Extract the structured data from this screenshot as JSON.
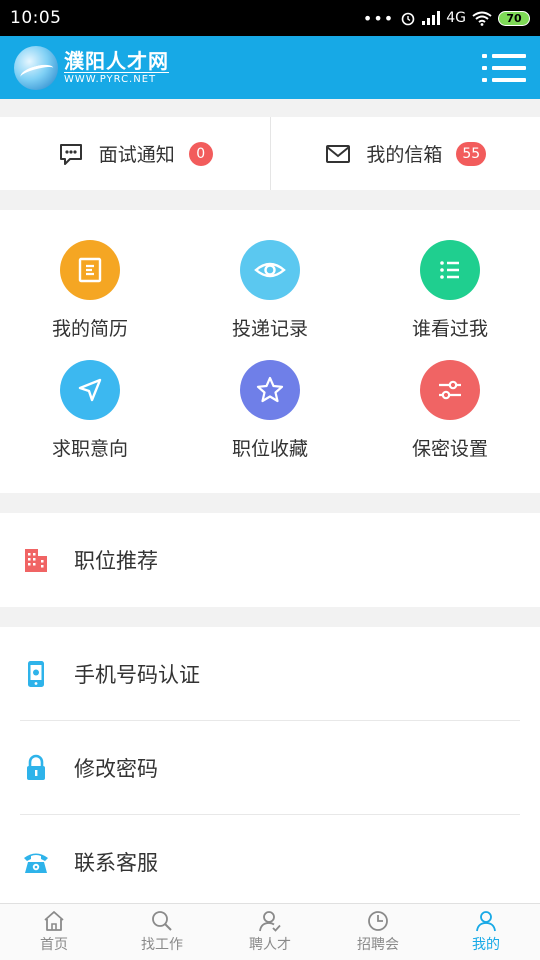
{
  "status_bar": {
    "time": "10:05",
    "network": "4G",
    "battery": "70"
  },
  "header": {
    "logo_cn": "濮阳人才网",
    "logo_en": "WWW.PYRC.NET"
  },
  "notifications": [
    {
      "label": "面试通知",
      "count": "0",
      "icon": "chat-bubble-icon"
    },
    {
      "label": "我的信箱",
      "count": "55",
      "icon": "envelope-icon"
    }
  ],
  "grid": [
    {
      "label": "我的简历",
      "icon": "document-icon",
      "color": "#f5a623"
    },
    {
      "label": "投递记录",
      "icon": "eye-icon",
      "color": "#5bc8f0"
    },
    {
      "label": "谁看过我",
      "icon": "list-icon",
      "color": "#1fcf8f"
    },
    {
      "label": "求职意向",
      "icon": "send-arrow-icon",
      "color": "#3cb8f0"
    },
    {
      "label": "职位收藏",
      "icon": "star-icon",
      "color": "#6f7fe8"
    },
    {
      "label": "保密设置",
      "icon": "sliders-icon",
      "color": "#f06464"
    }
  ],
  "recommend": {
    "label": "职位推荐",
    "icon": "building-icon"
  },
  "settings": [
    {
      "label": "手机号码认证",
      "icon": "phone-icon"
    },
    {
      "label": "修改密码",
      "icon": "lock-icon"
    },
    {
      "label": "联系客服",
      "icon": "telephone-icon"
    }
  ],
  "bottom_nav": [
    {
      "label": "首页",
      "icon": "home-icon"
    },
    {
      "label": "找工作",
      "icon": "search-icon"
    },
    {
      "label": "聘人才",
      "icon": "person-check-icon"
    },
    {
      "label": "招聘会",
      "icon": "clock-icon"
    },
    {
      "label": "我的",
      "icon": "user-icon",
      "active": true
    }
  ],
  "colors": {
    "brand": "#17a9e6",
    "badge": "#f25c5c",
    "nav_active": "#18a9e6"
  }
}
